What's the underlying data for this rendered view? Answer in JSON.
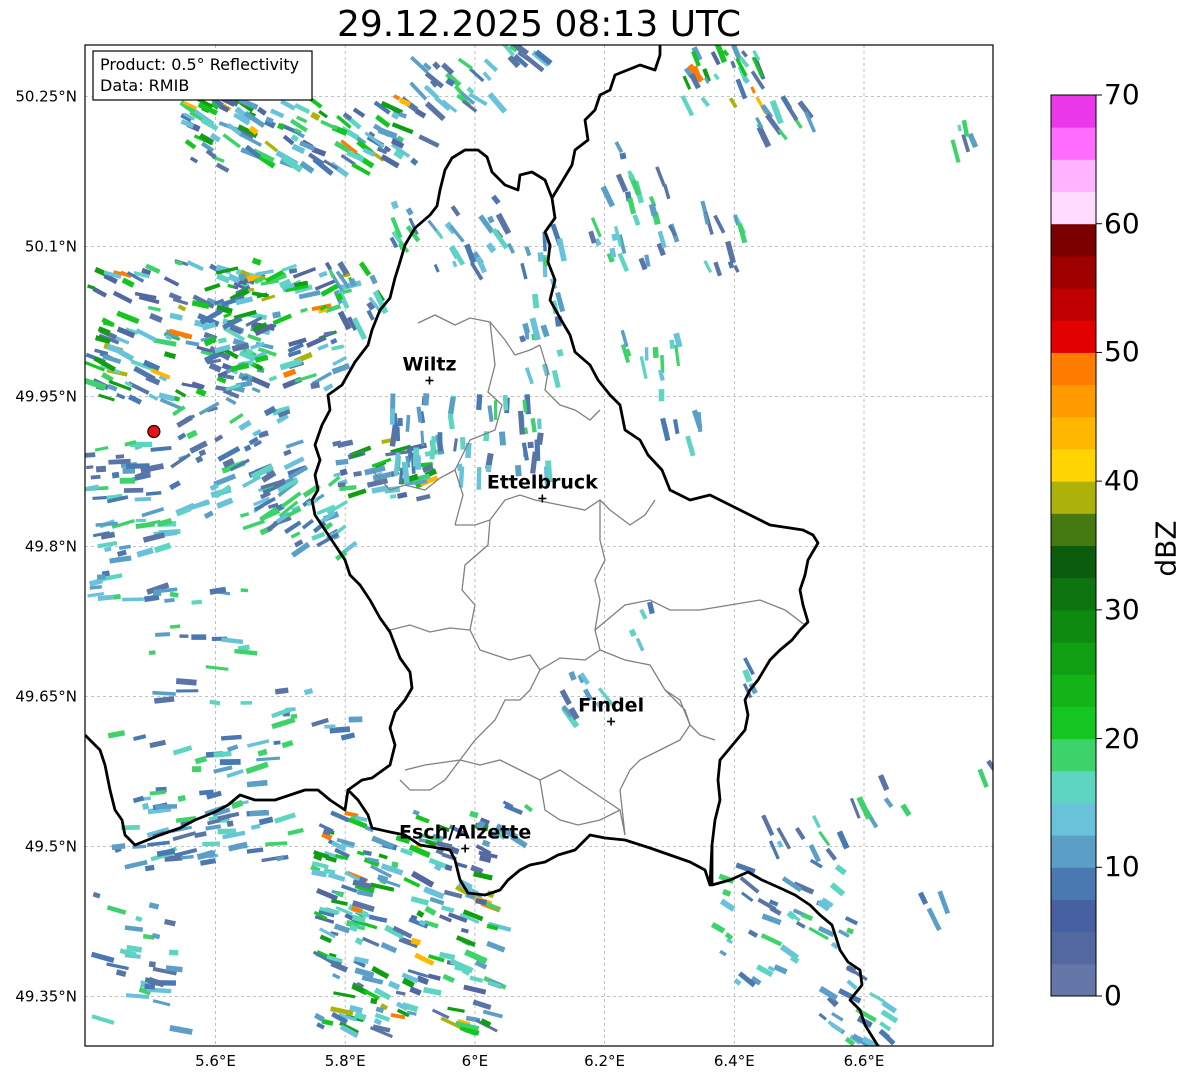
{
  "title": "29.12.2025 08:13 UTC",
  "info": {
    "product": "Product: 0.5° Reflectivity",
    "data": "Data: RMIB"
  },
  "lat_ticks": [
    "50.25°N",
    "50.1°N",
    "49.95°N",
    "49.8°N",
    "49.65°N",
    "49.5°N",
    "49.35°N"
  ],
  "lon_ticks": [
    "5.6°E",
    "5.8°E",
    "6°E",
    "6.2°E",
    "6.4°E",
    "6.6°E"
  ],
  "cities": [
    {
      "name": "Wiltz",
      "lon": 5.93,
      "lat": 49.966
    },
    {
      "name": "Ettelbruck",
      "lon": 6.104,
      "lat": 49.848
    },
    {
      "name": "Findel",
      "lon": 6.21,
      "lat": 49.625
    },
    {
      "name": "Esch/Alzette",
      "lon": 5.985,
      "lat": 49.498
    }
  ],
  "radar_site": {
    "lon": 5.505,
    "lat": 49.915
  },
  "colorbar": {
    "label": "dBZ",
    "ticks": [
      "0",
      "10",
      "20",
      "30",
      "40",
      "50",
      "60",
      "70"
    ],
    "colors": [
      "#6577a8",
      "#5367a0",
      "#4660a2",
      "#4a78b1",
      "#5b9ec6",
      "#67c2da",
      "#5ed4c2",
      "#3ed26a",
      "#14c61f",
      "#12b418",
      "#109f12",
      "#0f8a10",
      "#0d7410",
      "#0b5c0c",
      "#457a10",
      "#adb20a",
      "#ffd400",
      "#ffb700",
      "#ff9a00",
      "#ff7c00",
      "#e30000",
      "#c00000",
      "#9f0000",
      "#7a0000",
      "#ffdcff",
      "#ffb4ff",
      "#ff6cff",
      "#ea37ea"
    ]
  }
}
